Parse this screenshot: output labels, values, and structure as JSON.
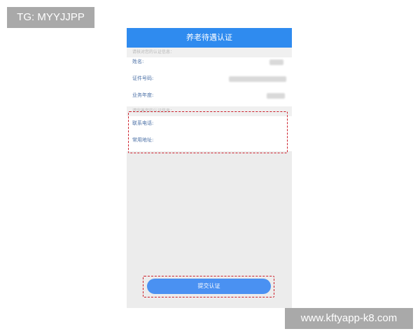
{
  "watermark_top": "TG: MYYJJPP",
  "watermark_bottom": "www.kftyapp-k8.com",
  "screen": {
    "title": "养老待遇认证",
    "section_verify": "请核对您的认证信息：",
    "fields": [
      {
        "label": "姓名:"
      },
      {
        "label": "证件号码:"
      },
      {
        "label": "业务年度:"
      }
    ],
    "section_fill": "请完善您的认证信息：",
    "inputs": [
      {
        "label": "联系电话:",
        "value": ""
      },
      {
        "label": "常用地址:",
        "value": ""
      }
    ],
    "submit_label": "提交认证"
  },
  "colors": {
    "title_bar": "#2f8bef",
    "button": "#4a91f2",
    "highlight_box": "#cc1f2a"
  }
}
